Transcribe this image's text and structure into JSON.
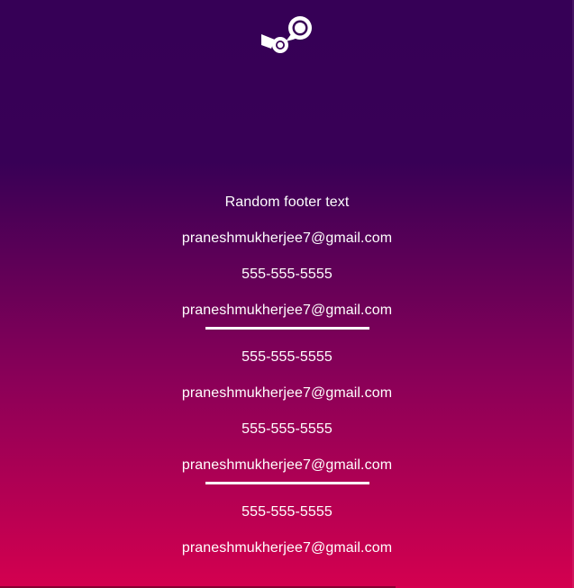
{
  "logo": {
    "icon": "steam-icon"
  },
  "footer": {
    "title": "Random footer text",
    "groups": [
      {
        "lines": [
          "praneshmukherjee7@gmail.com",
          "555-555-5555",
          "praneshmukherjee7@gmail.com"
        ]
      },
      {
        "lines": [
          "555-555-5555",
          "praneshmukherjee7@gmail.com",
          "555-555-5555",
          "praneshmukherjee7@gmail.com"
        ]
      },
      {
        "lines": [
          "555-555-5555",
          "praneshmukherjee7@gmail.com"
        ]
      }
    ]
  },
  "colors": {
    "gradient_top": "#360056",
    "gradient_mid": "#8a0058",
    "gradient_bottom": "#d4004f",
    "text": "#ffffff"
  }
}
